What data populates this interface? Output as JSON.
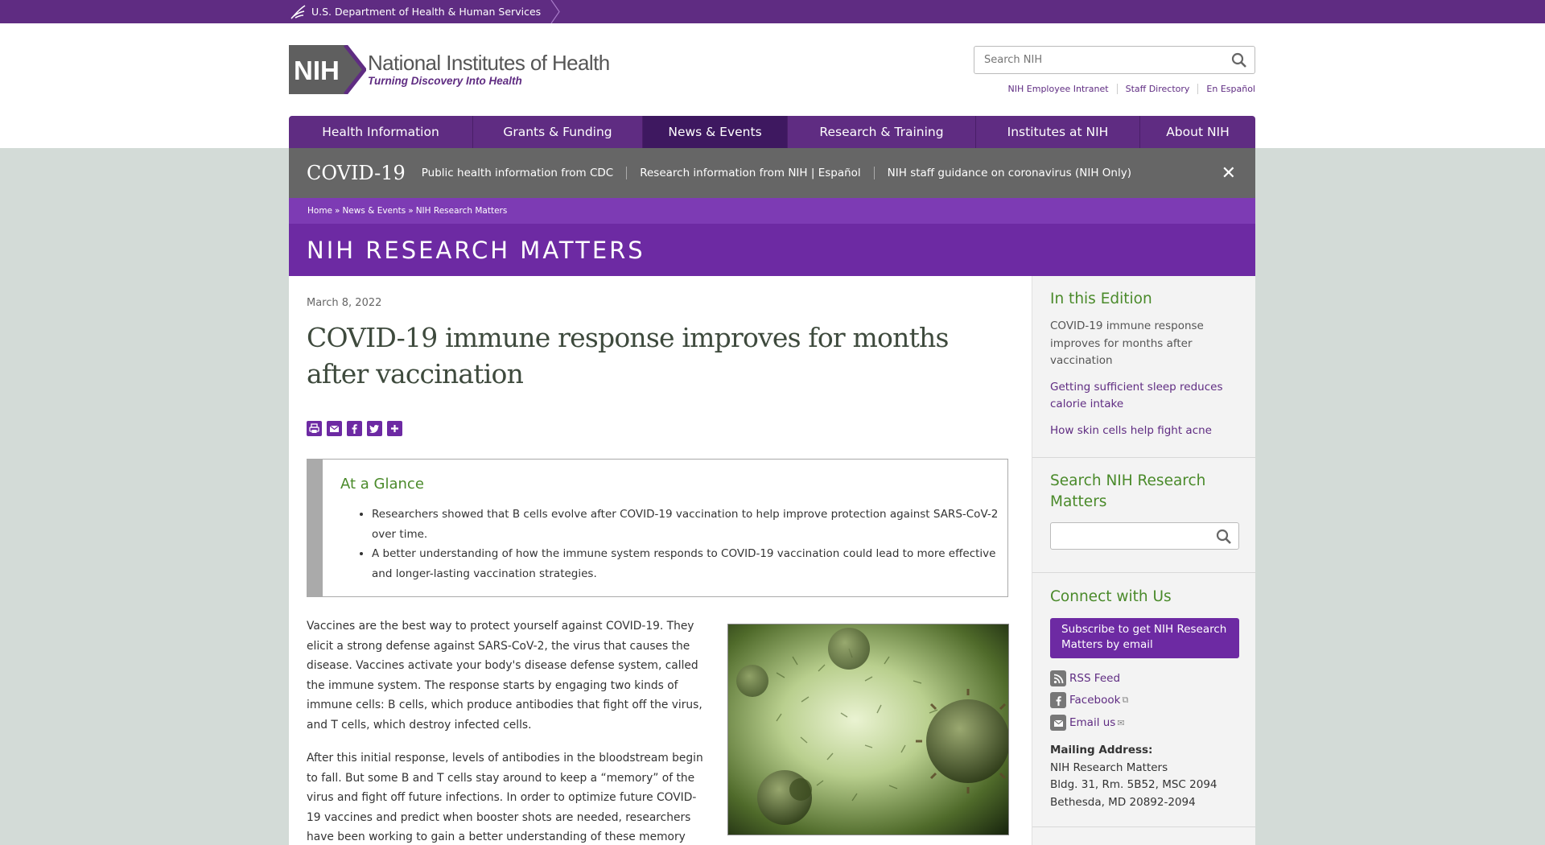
{
  "hhs": {
    "label": "U.S. Department of Health & Human Services"
  },
  "logo": {
    "badge": "NIH",
    "title": "National Institutes of Health",
    "tagline": "Turning Discovery Into Health"
  },
  "search": {
    "placeholder": "Search NIH"
  },
  "utility_links": [
    "NIH Employee Intranet",
    "Staff Directory",
    "En Español"
  ],
  "nav": [
    {
      "label": "Health Information",
      "width": 229
    },
    {
      "label": "Grants & Funding",
      "width": 211
    },
    {
      "label": "News & Events",
      "width": 180,
      "active": true
    },
    {
      "label": "Research & Training",
      "width": 234
    },
    {
      "label": "Institutes at NIH",
      "width": 204
    },
    {
      "label": "About NIH",
      "width": 143
    }
  ],
  "covid": {
    "title": "COVID-19",
    "links": [
      "Public health information from CDC",
      "Research information from NIH | Español",
      "NIH staff guidance on coronavirus (NIH Only)"
    ],
    "close": "✕"
  },
  "breadcrumb": {
    "home": "Home",
    "sep1": "»",
    "news": "News & Events",
    "sep2": "»",
    "current": "NIH Research Matters"
  },
  "section_title": "NIH RESEARCH MATTERS",
  "article": {
    "date": "March 8, 2022",
    "title": "COVID-19 immune response improves for months after vaccination",
    "glance_title": "At a Glance",
    "glance_items": [
      "Researchers showed that B cells evolve after COVID-19 vaccination to help improve protection against SARS-CoV-2 over time.",
      "A better understanding of how the immune system responds to COVID-19 vaccination could lead to more effective and longer-lasting vaccination strategies."
    ],
    "paragraphs": [
      "Vaccines are the best way to protect yourself against COVID-19. They elicit a strong defense against SARS-CoV-2, the virus that causes the disease. Vaccines activate your body's disease defense system, called the immune system. The response starts by engaging two kinds of immune cells: B cells, which produce antibodies that fight off the virus, and T cells, which destroy infected cells.",
      "After this initial response, levels of antibodies in the bloodstream begin to fall. But some B and T cells stay around to keep a “memory” of the virus and fight off future infections. In order to optimize future COVID-19 vaccines and predict when booster shots are needed, researchers have been working to gain a better understanding of these memory cells."
    ]
  },
  "sidebar": {
    "edition_title": "In this Edition",
    "edition_items": [
      {
        "label": "COVID-19 immune response improves for months after vaccination",
        "current": true
      },
      {
        "label": "Getting sufficient sleep reduces calorie intake",
        "current": false
      },
      {
        "label": "How skin cells help fight acne",
        "current": false
      }
    ],
    "search_title": "Search NIH Research Matters",
    "connect_title": "Connect with Us",
    "subscribe": "Subscribe to get NIH Research Matters by email",
    "social": [
      {
        "label": "RSS Feed",
        "icon": "rss-icon"
      },
      {
        "label": "Facebook",
        "icon": "facebook-icon"
      },
      {
        "label": "Email us",
        "icon": "email-icon"
      }
    ],
    "mailing_label": "Mailing Address:",
    "mailing_lines": [
      "NIH Research Matters",
      "Bldg. 31, Rm. 5B52, MSC 2094",
      "Bethesda, MD 20892-2094"
    ]
  },
  "colors": {
    "purple": "#5f2c82",
    "purple_mid": "#6d2aa3",
    "purple_light": "#7d3bb4",
    "green": "#4a8a2a",
    "gray_banner": "#666666"
  }
}
